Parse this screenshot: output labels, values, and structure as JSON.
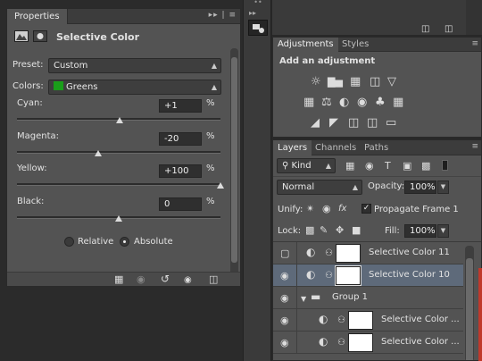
{
  "properties": {
    "tab": "Properties",
    "tab_menu": "▸▸ | ≡",
    "title": "Selective Color",
    "preset_label": "Preset:",
    "preset_value": "Custom",
    "colors_label": "Colors:",
    "colors_value": "Greens",
    "swatch": "#1a9e1a",
    "sliders": [
      {
        "label": "Cyan:",
        "value": "+1",
        "pct": "%",
        "level": 0.505
      },
      {
        "label": "Magenta:",
        "value": "-20",
        "pct": "%",
        "level": 0.4
      },
      {
        "label": "Yellow:",
        "value": "+100",
        "pct": "%",
        "level": 1.0
      },
      {
        "label": "Black:",
        "value": "0",
        "pct": "%",
        "level": 0.5
      }
    ],
    "relative_label": "Relative",
    "absolute_label": "Absolute",
    "method_selected": "Absolute"
  },
  "adjustments": {
    "tab_active": "Adjustments",
    "tab_other": "Styles",
    "heading": "Add an adjustment"
  },
  "layers": {
    "tabs": [
      "Layers",
      "Channels",
      "Paths"
    ],
    "kind_label": "Kind",
    "blend_mode": "Normal",
    "opacity_label": "Opacity:",
    "opacity_value": "100%",
    "unify_label": "Unify:",
    "propagate_label": "Propagate Frame 1",
    "lock_label": "Lock:",
    "fill_label": "Fill:",
    "fill_value": "100%",
    "rows": [
      {
        "name": "Selective Color 11"
      },
      {
        "name": "Selective Color 10"
      },
      {
        "name": "Group 1"
      },
      {
        "name": "Selective Color ..."
      },
      {
        "name": "Selective Color ..."
      }
    ]
  }
}
